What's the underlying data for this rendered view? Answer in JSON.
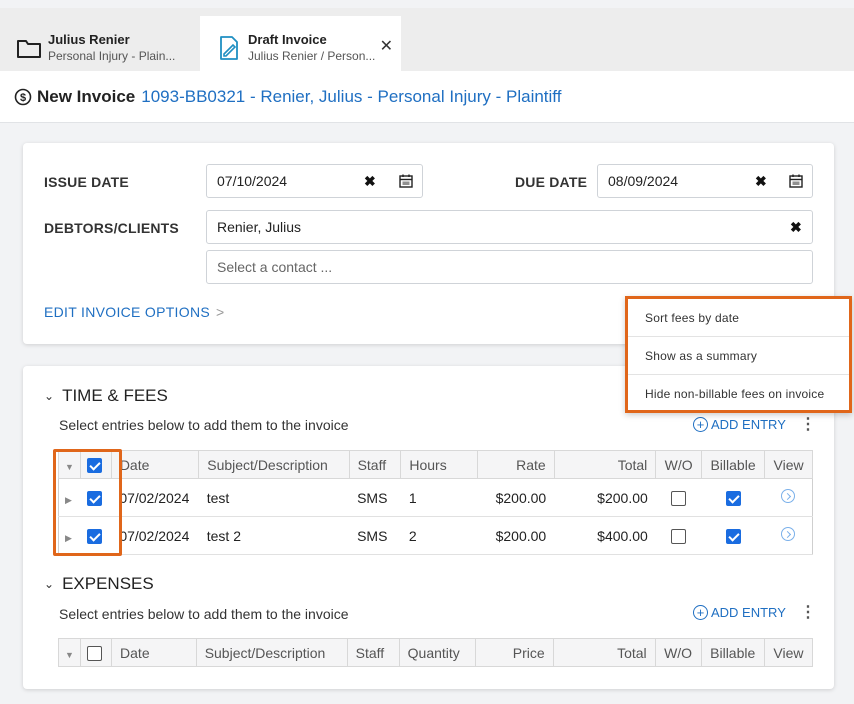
{
  "tabs": [
    {
      "title": "Julius Renier",
      "subtitle": "Personal Injury - Plain...",
      "icon": "folder-icon"
    },
    {
      "title": "Draft Invoice",
      "subtitle": "Julius Renier / Person...",
      "icon": "invoice-icon",
      "active": true
    }
  ],
  "header": {
    "title": "New Invoice",
    "matter_link": "1093-BB0321 - Renier, Julius - Personal Injury - Plaintiff"
  },
  "invoice": {
    "issue_date_label": "ISSUE DATE",
    "issue_date": "07/10/2024",
    "due_date_label": "DUE DATE",
    "due_date": "08/09/2024",
    "debtors_label": "DEBTORS/CLIENTS",
    "debtor": "Renier, Julius",
    "contact_placeholder": "Select a contact ...",
    "edit_options": "EDIT INVOICE OPTIONS"
  },
  "menu": {
    "items": [
      "Sort fees by date",
      "Show as a summary",
      "Hide non-billable fees on invoice"
    ]
  },
  "time_fees": {
    "title": "TIME & FEES",
    "subtitle": "Select entries below to add them to the invoice",
    "add_entry": "ADD ENTRY",
    "columns": [
      "Date",
      "Subject/Description",
      "Staff",
      "Hours",
      "Rate",
      "Total",
      "W/O",
      "Billable",
      "View"
    ],
    "rows": [
      {
        "date": "07/02/2024",
        "subject": "test",
        "staff": "SMS",
        "hours": "1",
        "rate": "$200.00",
        "total": "$200.00",
        "selected": true,
        "wo": false,
        "billable": true
      },
      {
        "date": "07/02/2024",
        "subject": "test 2",
        "staff": "SMS",
        "hours": "2",
        "rate": "$200.00",
        "total": "$400.00",
        "selected": true,
        "wo": false,
        "billable": true
      }
    ]
  },
  "expenses": {
    "title": "EXPENSES",
    "subtitle": "Select entries below to add them to the invoice",
    "add_entry": "ADD ENTRY",
    "columns": [
      "Date",
      "Subject/Description",
      "Staff",
      "Quantity",
      "Price",
      "Total",
      "W/O",
      "Billable",
      "View"
    ]
  },
  "colors": {
    "accent": "#1f6fc2",
    "highlight": "#e0661a",
    "checkbox": "#1a6ce0"
  }
}
